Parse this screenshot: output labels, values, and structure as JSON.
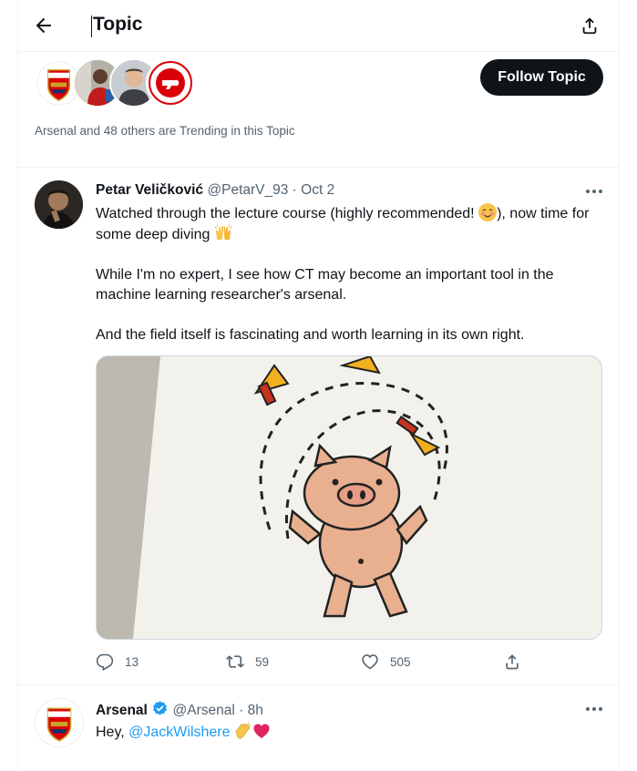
{
  "header": {
    "title": "Topic"
  },
  "topic": {
    "follow_label": "Follow Topic",
    "trending_text": "Arsenal and 48 others are Trending in this Topic",
    "avatars": [
      "arsenal-crest",
      "player-photo",
      "player-photo",
      "club-badge"
    ]
  },
  "tweets": [
    {
      "name": "Petar Veličković",
      "handle": "@PetarV_93",
      "sep": "·",
      "time": "Oct 2",
      "text": {
        "p1a": "Watched through the lecture course (highly recommended! ",
        "p1b": "), now time for some deep diving ",
        "p2": "While I'm no expert, I see how CT may become an important tool in the machine learning researcher's arsenal.",
        "p3": "And the field itself is fascinating and worth learning in its own right."
      },
      "media_description_icon": "pig-drawing-image",
      "stats": {
        "replies": "13",
        "retweets": "59",
        "likes": "505"
      }
    },
    {
      "name": "Arsenal",
      "handle": "@Arsenal",
      "sep": "·",
      "time": "8h",
      "verified": true,
      "text": {
        "prefix": "Hey, ",
        "mention": "@JackWilshere"
      }
    }
  ],
  "colors": {
    "accent": "#1d9bf0",
    "text": "#0f1419",
    "muted": "#536471",
    "arsenal_red": "#db0007"
  }
}
